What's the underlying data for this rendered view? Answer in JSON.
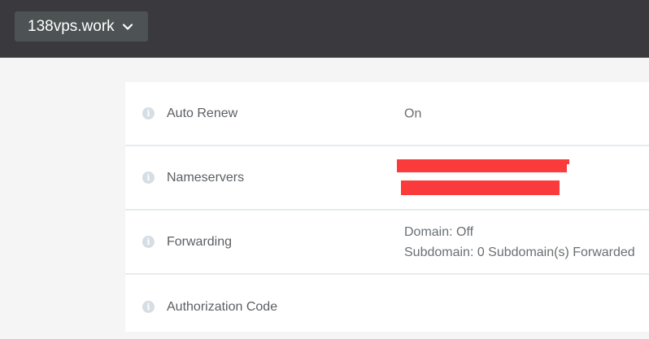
{
  "header": {
    "domain": "138vps.work",
    "dropdown_icon": "chevron-down-icon"
  },
  "settings": {
    "rows": [
      {
        "label": "Auto Renew",
        "value": "On",
        "icon": "info-icon"
      },
      {
        "label": "Nameservers",
        "value": "",
        "icon": "info-icon"
      },
      {
        "label": "Forwarding",
        "value_line1": "Domain: Off",
        "value_line2": "Subdomain: 0 Subdomain(s) Forwarded",
        "icon": "info-icon"
      },
      {
        "label": "Authorization Code",
        "value": "",
        "icon": "info-icon"
      }
    ]
  },
  "colors": {
    "topbar": "#3a393d",
    "select_bg": "#4d5254",
    "redaction": "#fb3a3b",
    "icon": "#d6dde3"
  }
}
